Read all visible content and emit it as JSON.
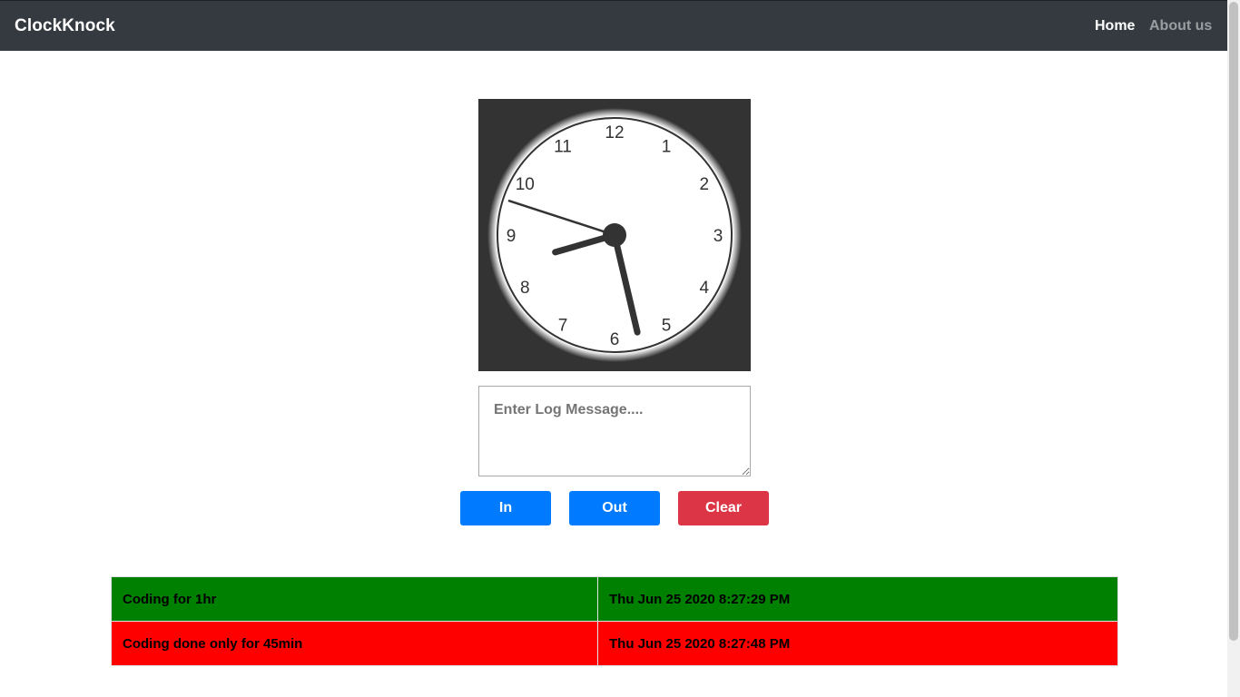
{
  "navbar": {
    "brand": "ClockKnock",
    "links": [
      {
        "label": "Home",
        "active": true
      },
      {
        "label": "About us",
        "active": false
      }
    ],
    "background": "#343a40"
  },
  "clock": {
    "numbers": [
      "12",
      "1",
      "2",
      "3",
      "4",
      "5",
      "6",
      "7",
      "8",
      "9",
      "10",
      "11"
    ],
    "time": {
      "hour": 8,
      "minute": 27,
      "second": 48
    },
    "face_color": "#ffffff",
    "frame_color": "#333333"
  },
  "log_input": {
    "placeholder": "Enter Log Message....",
    "value": ""
  },
  "buttons": {
    "in_label": "In",
    "out_label": "Out",
    "clear_label": "Clear",
    "primary_color": "#007bff",
    "danger_color": "#dc3545"
  },
  "log_table": {
    "rows": [
      {
        "message": "Coding for 1hr",
        "timestamp": "Thu Jun 25 2020 8:27:29 PM",
        "type": "in",
        "color": "#008000"
      },
      {
        "message": "Coding done only for 45min",
        "timestamp": "Thu Jun 25 2020 8:27:48 PM",
        "type": "out",
        "color": "#ff0000"
      }
    ]
  }
}
